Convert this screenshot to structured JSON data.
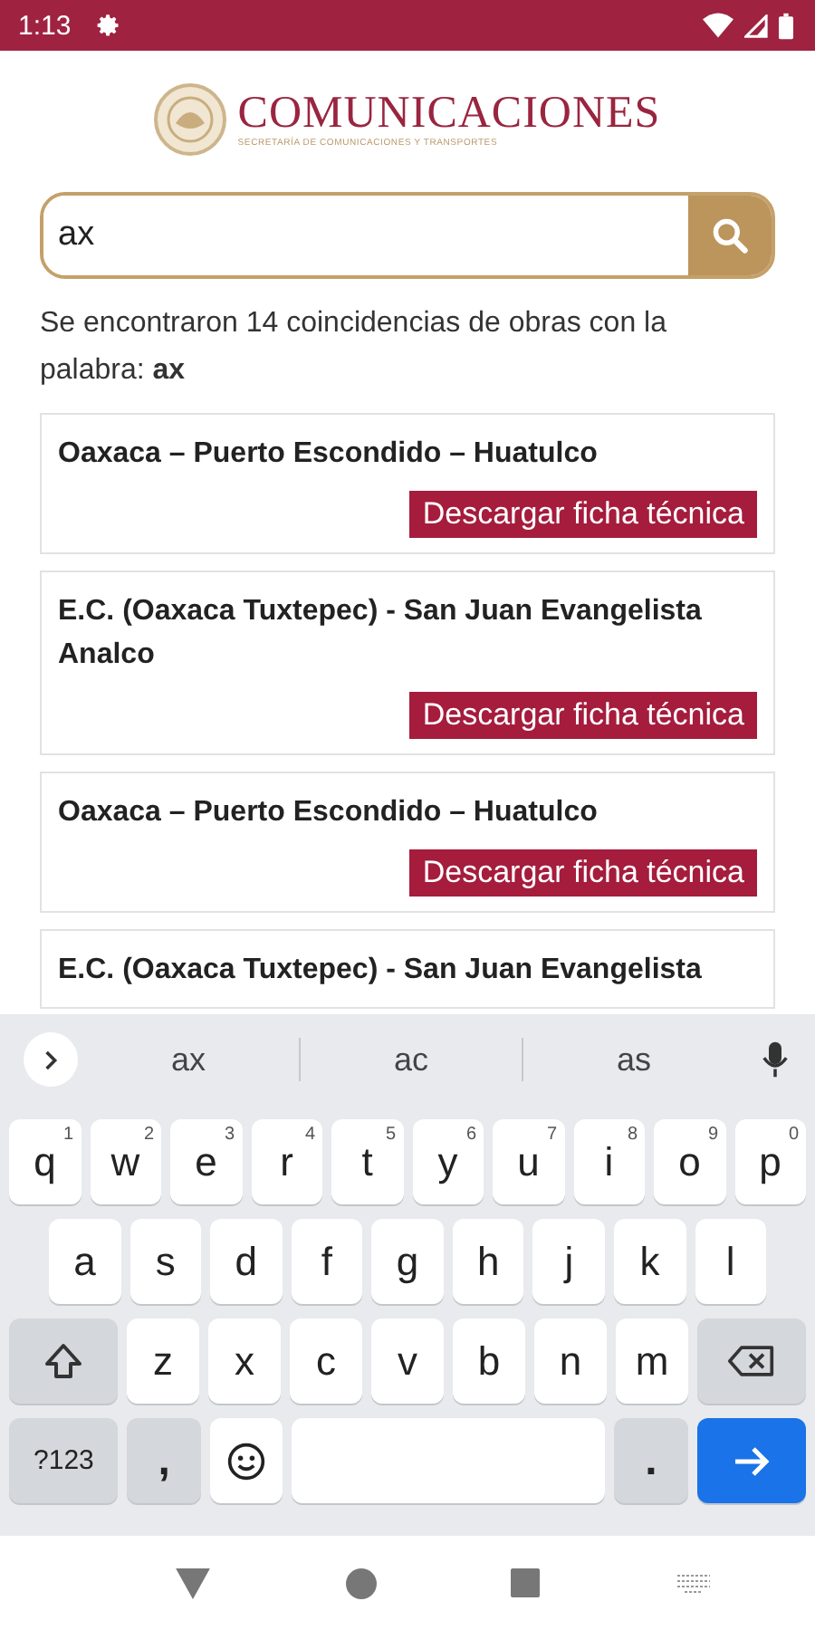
{
  "status_bar": {
    "time": "1:13"
  },
  "header": {
    "title": "COMUNICACIONES",
    "subtitle": "SECRETARÍA DE COMUNICACIONES Y TRANSPORTES"
  },
  "search": {
    "value": "ax"
  },
  "result_text": "Se encontraron 14 coincidencias de obras con la palabra: **ax**",
  "results": [
    {
      "title": "Oaxaca – Puerto Escondido – Huatulco",
      "button": "Descargar ficha técnica"
    },
    {
      "title": "E.C. (Oaxaca Tuxtepec) - San Juan Evangelista Analco",
      "button": "Descargar ficha técnica"
    },
    {
      "title": "Oaxaca – Puerto Escondido – Huatulco",
      "button": "Descargar ficha técnica"
    },
    {
      "title": "E.C. (Oaxaca Tuxtepec) - San Juan Evangelista"
    }
  ],
  "keyboard": {
    "suggestions": [
      "ax",
      "ac",
      "as"
    ],
    "key_rows": [
      {
        "keys": [
          {
            "kind": "letter",
            "label": "q",
            "hint": "1"
          },
          {
            "kind": "letter",
            "label": "w",
            "hint": "2"
          },
          {
            "kind": "letter",
            "label": "e",
            "hint": "3"
          },
          {
            "kind": "letter",
            "label": "r",
            "hint": "4"
          },
          {
            "kind": "letter",
            "label": "t",
            "hint": "5"
          },
          {
            "kind": "letter",
            "label": "y",
            "hint": "6"
          },
          {
            "kind": "letter",
            "label": "u",
            "hint": "7"
          },
          {
            "kind": "letter",
            "label": "i",
            "hint": "8"
          },
          {
            "kind": "letter",
            "label": "o",
            "hint": "9"
          },
          {
            "kind": "letter",
            "label": "p",
            "hint": "0"
          }
        ]
      },
      {
        "keys": [
          {
            "kind": "letter",
            "label": "a"
          },
          {
            "kind": "letter",
            "label": "s"
          },
          {
            "kind": "letter",
            "label": "d"
          },
          {
            "kind": "letter",
            "label": "f"
          },
          {
            "kind": "letter",
            "label": "g"
          },
          {
            "kind": "letter",
            "label": "h"
          },
          {
            "kind": "letter",
            "label": "j"
          },
          {
            "kind": "letter",
            "label": "k"
          },
          {
            "kind": "letter",
            "label": "l"
          }
        ]
      },
      {
        "keys": [
          {
            "kind": "shift"
          },
          {
            "kind": "letter",
            "label": "z"
          },
          {
            "kind": "letter",
            "label": "x"
          },
          {
            "kind": "letter",
            "label": "c"
          },
          {
            "kind": "letter",
            "label": "v"
          },
          {
            "kind": "letter",
            "label": "b"
          },
          {
            "kind": "letter",
            "label": "n"
          },
          {
            "kind": "letter",
            "label": "m"
          },
          {
            "kind": "backspace"
          }
        ]
      },
      {
        "keys": [
          {
            "kind": "symbols",
            "label": "?123"
          },
          {
            "kind": "punct",
            "label": ","
          },
          {
            "kind": "emoji"
          },
          {
            "kind": "space"
          },
          {
            "kind": "punct",
            "label": "."
          },
          {
            "kind": "enter"
          }
        ]
      }
    ]
  }
}
